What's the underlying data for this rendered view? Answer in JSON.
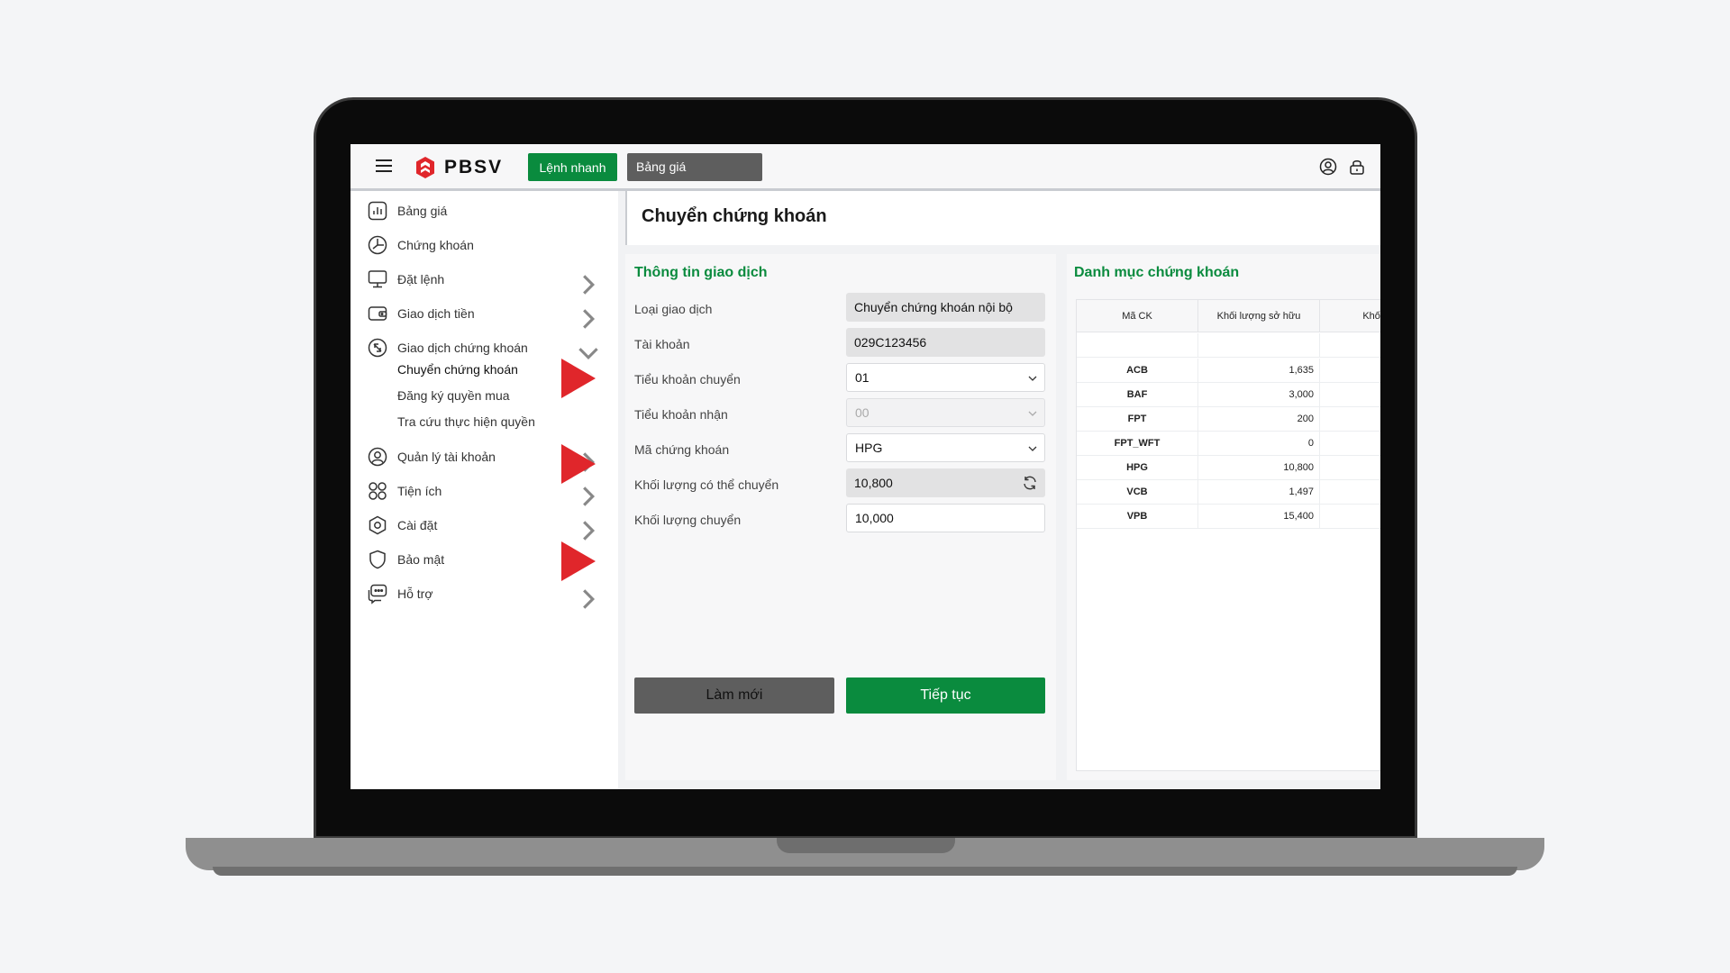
{
  "app": {
    "logo_text": "PBSV",
    "quick_order_label": "Lệnh nhanh",
    "price_board_label": "Bảng giá"
  },
  "icons": {
    "menu": "hamburger-icon",
    "user": "user-circle-icon",
    "lock": "lock-icon"
  },
  "colors": {
    "brand_green": "#0a8b3e",
    "brand_red": "#e0262b",
    "dark_button": "#5e5e5e"
  },
  "sidebar": {
    "items": [
      {
        "label": "Bảng giá",
        "icon": "chart-icon",
        "has_arrow": false
      },
      {
        "label": "Chứng khoán",
        "icon": "pie-icon",
        "has_arrow": false
      },
      {
        "label": "Đặt lệnh",
        "icon": "monitor-icon",
        "has_arrow": true
      },
      {
        "label": "Giao dịch tiền",
        "icon": "wallet-icon",
        "has_arrow": true
      },
      {
        "label": "Giao dịch chứng khoán",
        "icon": "exchange-icon",
        "has_arrow": true,
        "expanded": true
      },
      {
        "label": "Quản lý tài khoản",
        "icon": "user-icon",
        "has_arrow": true
      },
      {
        "label": "Tiện ích",
        "icon": "grid-icon",
        "has_arrow": true
      },
      {
        "label": "Cài đặt",
        "icon": "settings-icon",
        "has_arrow": true
      },
      {
        "label": "Bảo mật",
        "icon": "shield-icon",
        "has_arrow": false
      },
      {
        "label": "Hỗ trợ",
        "icon": "chat-icon",
        "has_arrow": true
      }
    ],
    "sub_items": [
      {
        "label": "Chuyển chứng khoán",
        "active": true
      },
      {
        "label": "Đăng ký quyền mua",
        "active": false
      },
      {
        "label": "Tra cứu thực hiện quyền",
        "active": false
      }
    ]
  },
  "page": {
    "title": "Chuyển chứng khoán"
  },
  "form": {
    "title": "Thông tin giao dịch",
    "fields": [
      {
        "label": "Loại giao dịch",
        "value": "Chuyển chứng khoán nội bộ"
      },
      {
        "label": "Tài khoản",
        "value": "029C123456"
      },
      {
        "label": "Tiểu khoản chuyển",
        "value": "01"
      },
      {
        "label": "Tiểu khoản nhận",
        "value": "00"
      },
      {
        "label": "Mã chứng khoán",
        "value": "HPG"
      },
      {
        "label": "Khối lượng có thể chuyển",
        "value": "10,800"
      },
      {
        "label": "Khối lượng chuyển",
        "value": "10,000"
      }
    ],
    "reset_label": "Làm mới",
    "continue_label": "Tiếp tục"
  },
  "portfolio": {
    "title": "Danh mục chứng khoán",
    "columns": [
      "Mã CK",
      "Khối lượng sở hữu",
      "Khối lượng"
    ],
    "rows": [
      {
        "symbol": "ACB",
        "owned": "1,635"
      },
      {
        "symbol": "BAF",
        "owned": "3,000"
      },
      {
        "symbol": "FPT",
        "owned": "200"
      },
      {
        "symbol": "FPT_WFT",
        "owned": "0"
      },
      {
        "symbol": "HPG",
        "owned": "10,800"
      },
      {
        "symbol": "VCB",
        "owned": "1,497"
      },
      {
        "symbol": "VPB",
        "owned": "15,400"
      }
    ]
  }
}
